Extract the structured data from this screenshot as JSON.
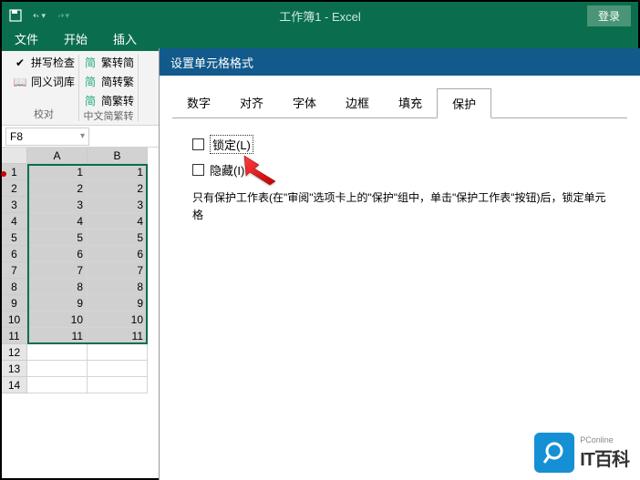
{
  "titlebar": {
    "title": "工作簿1 - Excel",
    "login": "登录"
  },
  "ribbon": {
    "tabs": [
      "文件",
      "开始",
      "插入"
    ]
  },
  "groups": {
    "proofing": {
      "items": [
        "拼写检查",
        "同义词库"
      ],
      "label": "校对"
    },
    "chinese": {
      "items": [
        "繁转简",
        "简转繁",
        "简繁转"
      ],
      "label": "中文简繁转"
    }
  },
  "namebox": "F8",
  "sheet": {
    "cols": [
      "A",
      "B"
    ],
    "rows": [
      {
        "n": 1,
        "a": 1,
        "b": 1
      },
      {
        "n": 2,
        "a": 2,
        "b": 2
      },
      {
        "n": 3,
        "a": 3,
        "b": 3
      },
      {
        "n": 4,
        "a": 4,
        "b": 4
      },
      {
        "n": 5,
        "a": 5,
        "b": 5
      },
      {
        "n": 6,
        "a": 6,
        "b": 6
      },
      {
        "n": 7,
        "a": 7,
        "b": 7
      },
      {
        "n": 8,
        "a": 8,
        "b": 8
      },
      {
        "n": 9,
        "a": 9,
        "b": 9
      },
      {
        "n": 10,
        "a": 10,
        "b": 10
      },
      {
        "n": 11,
        "a": 11,
        "b": 11
      },
      {
        "n": 12,
        "a": "",
        "b": ""
      },
      {
        "n": 13,
        "a": "",
        "b": ""
      },
      {
        "n": 14,
        "a": "",
        "b": ""
      }
    ]
  },
  "dialog": {
    "title": "设置单元格格式",
    "tabs": [
      "数字",
      "对齐",
      "字体",
      "边框",
      "填充",
      "保护"
    ],
    "activeTab": 5,
    "lock": "锁定(L)",
    "hide": "隐藏(I)",
    "help": "只有保护工作表(在\"审阅\"选项卡上的\"保护\"组中，单击\"保护工作表\"按钮)后，锁定单元格"
  },
  "watermark": {
    "top": "PConline",
    "main": "IT百科"
  }
}
